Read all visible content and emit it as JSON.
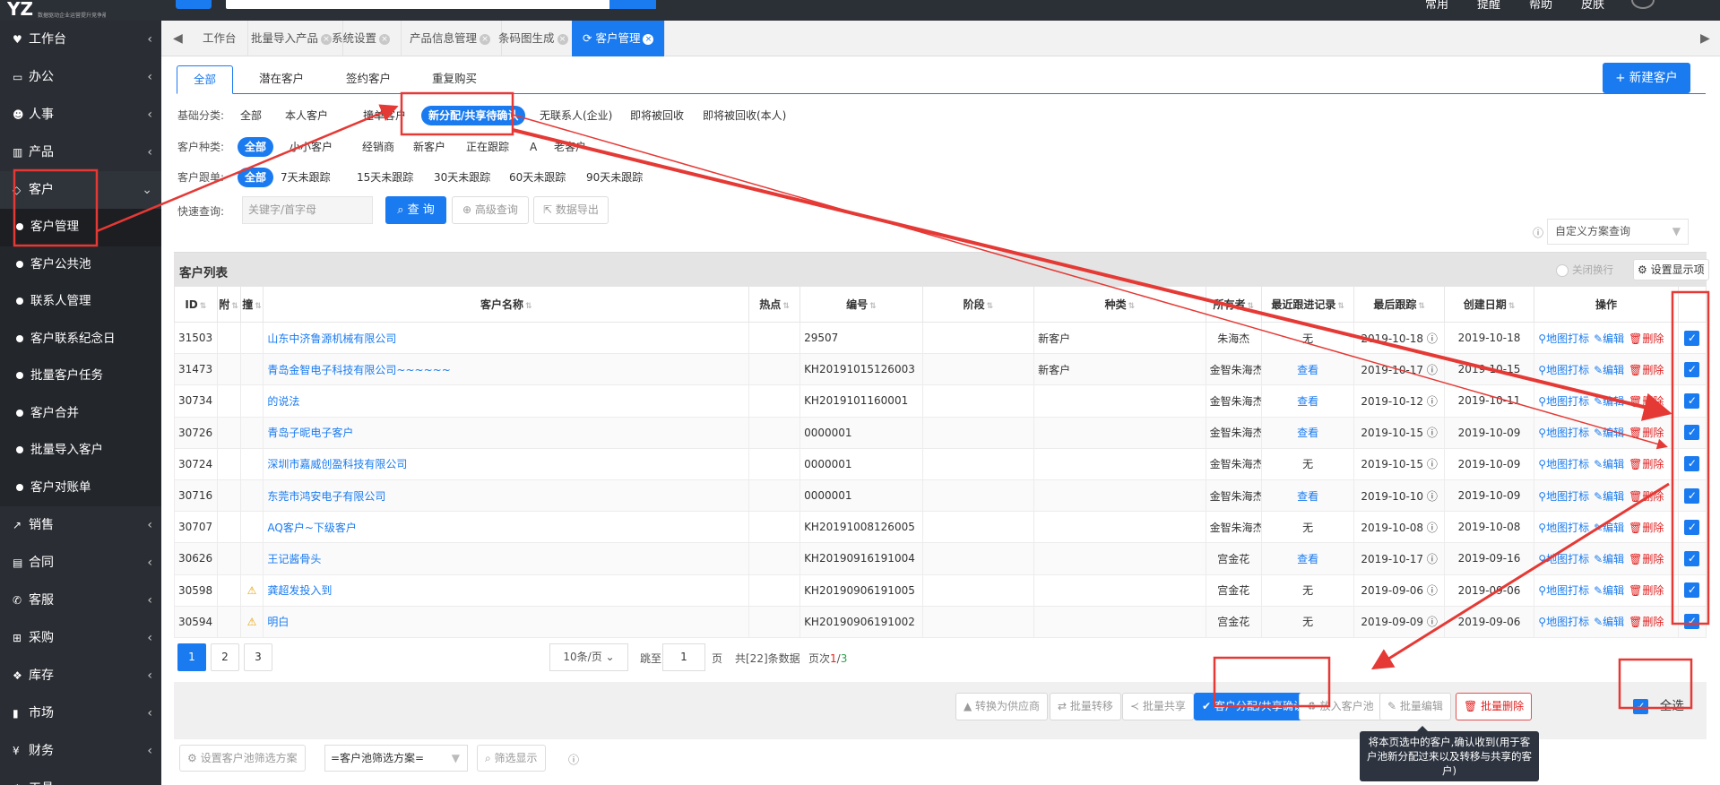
{
  "topbar": {
    "logo": "YZ",
    "logo_sub": "数据驱动企业运营提升竞争能力",
    "links": [
      "常用",
      "提醒",
      "帮助",
      "皮肤"
    ]
  },
  "sidebar": {
    "top_items": [
      {
        "label": "工作台",
        "icon": "heart-icon",
        "glyph": "♥"
      },
      {
        "label": "办公",
        "icon": "laptop-icon",
        "glyph": "▭"
      },
      {
        "label": "人事",
        "icon": "users-icon",
        "glyph": "☻"
      },
      {
        "label": "产品",
        "icon": "barcode-icon",
        "glyph": "▥"
      },
      {
        "label": "客户",
        "icon": "diamond-icon",
        "glyph": "◇"
      }
    ],
    "sub_items": [
      "客户管理",
      "客户公共池",
      "联系人管理",
      "客户联系纪念日",
      "批量客户任务",
      "客户合并",
      "批量导入客户",
      "客户对账单"
    ],
    "bottom_items": [
      {
        "label": "销售",
        "icon": "chart-icon",
        "glyph": "↗"
      },
      {
        "label": "合同",
        "icon": "contract-icon",
        "glyph": "▤"
      },
      {
        "label": "客服",
        "icon": "phone-icon",
        "glyph": "✆"
      },
      {
        "label": "采购",
        "icon": "cart-icon",
        "glyph": "⊞"
      },
      {
        "label": "库存",
        "icon": "cubes-icon",
        "glyph": "❖"
      },
      {
        "label": "市场",
        "icon": "bookmark-icon",
        "glyph": "▮"
      },
      {
        "label": "财务",
        "icon": "yen-icon",
        "glyph": "¥"
      },
      {
        "label": "工具",
        "icon": "cog-icon",
        "glyph": "⚙"
      }
    ]
  },
  "tabs": [
    "工作台",
    "批量导入产品",
    "系统设置",
    "产品信息管理",
    "条码图生成",
    "客户管理"
  ],
  "subtabs": [
    "全部",
    "潜在客户",
    "签约客户",
    "重复购买"
  ],
  "new_button": "+ 新建客户",
  "filters": {
    "base": {
      "label": "基础分类:",
      "chips": [
        "全部",
        "本人客户",
        "撞单客户",
        "新分配/共享待确认",
        "无联系人(企业)",
        "即将被回收",
        "即将被回收(本人)"
      ]
    },
    "type": {
      "label": "客户种类:",
      "chips": [
        "全部",
        "小小客户",
        "经销商",
        "新客户",
        "正在跟踪",
        "A",
        "老客户"
      ]
    },
    "follow": {
      "label": "客户跟单:",
      "chips": [
        "全部",
        "7天未跟踪",
        "15天未跟踪",
        "30天未跟踪",
        "60天未跟踪",
        "90天未跟踪"
      ]
    }
  },
  "quick": {
    "label": "快速查询:",
    "placeholder": "关键字/首字母",
    "search": "查 询",
    "advanced": "高级查询",
    "export": "数据导出",
    "scheme": "自定义方案查询"
  },
  "list": {
    "title": "客户列表",
    "toggle": "关闭换行",
    "settings": "设置显示项"
  },
  "columns": [
    "ID",
    "附",
    "撞",
    "客户名称",
    "热点",
    "编号",
    "阶段",
    "种类",
    "所有者",
    "最近跟进记录",
    "最后跟踪",
    "创建日期",
    "操作"
  ],
  "actions": {
    "map": "地图打标",
    "edit": "编辑",
    "delete": "删除"
  },
  "rows": [
    {
      "id": "31503",
      "warn": false,
      "name": "山东中济鲁源机械有限公司",
      "code": "29507",
      "type": "新客户",
      "owner": "朱海杰",
      "record": "无",
      "last": "2019-10-18",
      "created": "2019-10-18"
    },
    {
      "id": "31473",
      "warn": false,
      "name": "青岛金智电子科技有限公司~~~~~~",
      "code": "KH20191015126003",
      "type": "新客户",
      "owner": "金智朱海杰",
      "record": "查看",
      "last": "2019-10-17",
      "created": "2019-10-15"
    },
    {
      "id": "30734",
      "warn": false,
      "name": "的说法",
      "code": "KH2019101160001",
      "type": "",
      "owner": "金智朱海杰",
      "record": "查看",
      "last": "2019-10-12",
      "created": "2019-10-11"
    },
    {
      "id": "30726",
      "warn": false,
      "name": "青岛子昵电子客户",
      "code": "0000001",
      "type": "",
      "owner": "金智朱海杰",
      "record": "查看",
      "last": "2019-10-15",
      "created": "2019-10-09"
    },
    {
      "id": "30724",
      "warn": false,
      "name": "深圳市嘉威创盈科技有限公司",
      "code": "0000001",
      "type": "",
      "owner": "金智朱海杰",
      "record": "无",
      "last": "2019-10-15",
      "created": "2019-10-09"
    },
    {
      "id": "30716",
      "warn": false,
      "name": "东莞市鸿安电子有限公司",
      "code": "0000001",
      "type": "",
      "owner": "金智朱海杰",
      "record": "查看",
      "last": "2019-10-10",
      "created": "2019-10-09"
    },
    {
      "id": "30707",
      "warn": false,
      "name": "AQ客户~下级客户",
      "code": "KH20191008126005",
      "type": "",
      "owner": "金智朱海杰",
      "record": "无",
      "last": "2019-10-08",
      "created": "2019-10-08"
    },
    {
      "id": "30626",
      "warn": false,
      "name": "王记酱骨头",
      "code": "KH20190916191004",
      "type": "",
      "owner": "宫金花",
      "record": "查看",
      "last": "2019-10-17",
      "created": "2019-09-16"
    },
    {
      "id": "30598",
      "warn": true,
      "name": "龚超发投入到",
      "code": "KH20190906191005",
      "type": "",
      "owner": "宫金花",
      "record": "无",
      "last": "2019-09-06",
      "created": "2019-09-06"
    },
    {
      "id": "30594",
      "warn": true,
      "name": "明白",
      "code": "KH20190906191002",
      "type": "",
      "owner": "宫金花",
      "record": "无",
      "last": "2019-09-09",
      "created": "2019-09-06"
    }
  ],
  "pager": {
    "pages": [
      "1",
      "2",
      "3"
    ],
    "size": "10条/页",
    "jump": "跳至",
    "jump_val": "1",
    "page_unit": "页",
    "total": "共[22]条数据",
    "pageinfo": "页次",
    "cur": "1",
    "sep": "/",
    "all": "3"
  },
  "bulk": {
    "supplier": "转换为供应商",
    "transfer": "批量转移",
    "share": "批量共享",
    "confirm": "客户分配/共享确认",
    "pool": "放入客户池",
    "edit": "批量编辑",
    "delete": "批量删除",
    "select_all": "全选"
  },
  "tooltip": "将本页选中的客户,确认收到(用于客户池新分配过来以及转移与共享的客户)",
  "pool_filter": {
    "settings": "设置客户池筛选方案",
    "scheme": "=客户池筛选方案=",
    "show": "筛选显示"
  },
  "colors": {
    "accent": "#1a7bf0",
    "sidebar": "#2a2d33",
    "danger": "#e02020",
    "annotation": "#e53935"
  }
}
